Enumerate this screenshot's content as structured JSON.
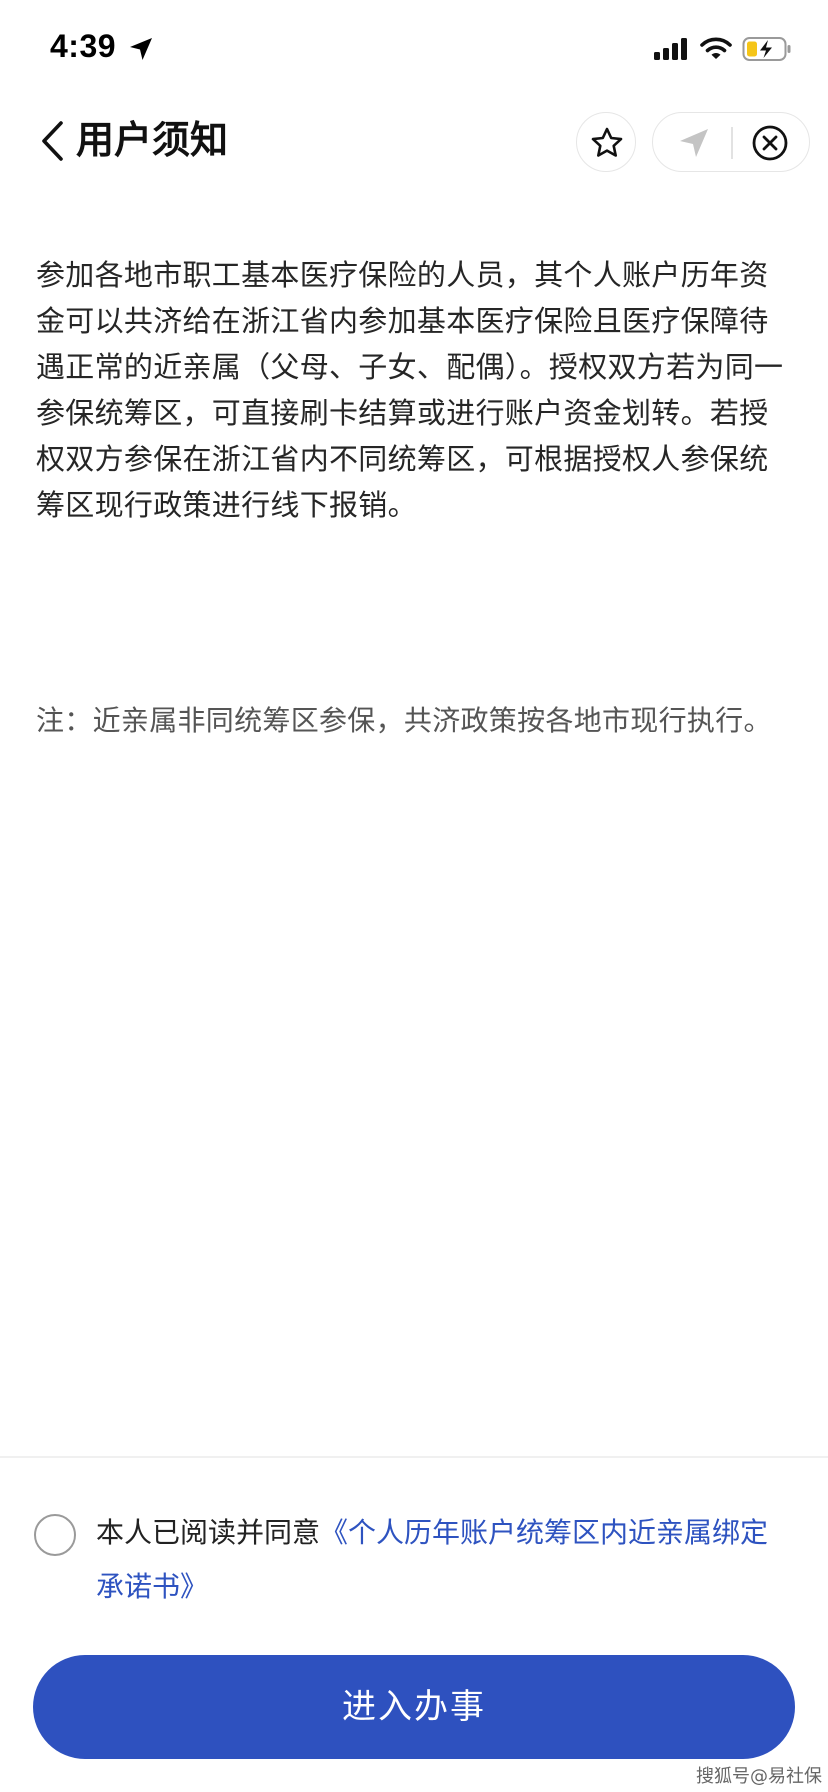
{
  "status_bar": {
    "time": "4:39"
  },
  "nav": {
    "title": "用户须知"
  },
  "content": {
    "body": "参加各地市职工基本医疗保险的人员，其个人账户历年资金可以共济给在浙江省内参加基本医疗保险且医疗保障待遇正常的近亲属（父母、子女、配偶）。授权双方若为同一参保统筹区，可直接刷卡结算或进行账户资金划转。若授权双方参保在浙江省内不同统筹区，可根据授权人参保统筹区现行政策进行线下报销。",
    "note": "注：近亲属非同统筹区参保，共济政策按各地市现行执行。"
  },
  "agreement": {
    "checked": false,
    "prefix": "本人已阅读并同意",
    "link": "《个人历年账户统筹区内近亲属绑定承诺书》"
  },
  "actions": {
    "enter_label": "进入办事"
  },
  "watermark": "搜狐号@易社保",
  "colors": {
    "primary": "#2e51bf",
    "link": "#2e53c0",
    "battery_fill": "#f5c518"
  },
  "icons": {
    "location": "location-arrow-icon",
    "signal": "cellular-signal-icon",
    "wifi": "wifi-icon",
    "battery": "battery-charging-icon",
    "back": "chevron-left-icon",
    "favorite": "star-icon",
    "navigate": "navigation-arrow-icon",
    "close": "close-circle-icon"
  }
}
